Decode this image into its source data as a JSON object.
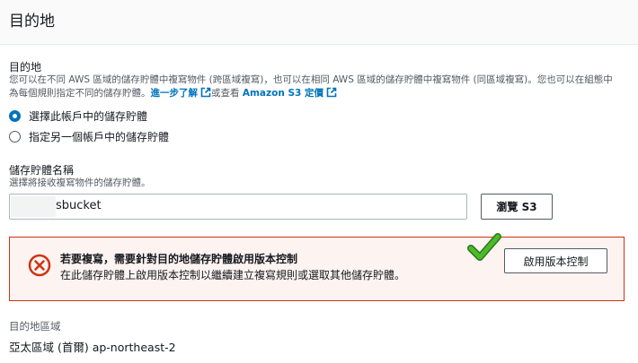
{
  "header": {
    "title": "目的地"
  },
  "destination": {
    "label": "目的地",
    "desc_line1": "您可以在不同 AWS 區域的儲存貯體中複寫物件 (跨區域複寫)，也可以在相同 AWS 區域的儲存貯體中複寫物件 (同區域複寫)。您也可以在組態中",
    "desc_line2_prefix": "為每個規則指定不同的儲存貯體。",
    "learn_more_link": "進一步了解",
    "desc_or": "或查看",
    "pricing_link": "Amazon S3 定價"
  },
  "radios": [
    {
      "label": "選擇此帳戶中的儲存貯體",
      "checked": true
    },
    {
      "label": "指定另一個帳戶中的儲存貯體",
      "checked": false
    }
  ],
  "bucket": {
    "label": "儲存貯體名稱",
    "hint": "選擇將接收複寫物件的儲存貯體。",
    "value": "sbucket",
    "browse_button": "瀏覽 S3"
  },
  "alert": {
    "title": "若要複寫，需要針對目的地儲存貯體啟用版本控制",
    "description": "在此儲存貯體上啟用版本控制以繼續建立複寫規則或選取其他儲存貯體。",
    "button": "啟用版本控制",
    "icon": "error-circle-icon"
  },
  "annotation": {
    "icon": "green-checkmark-icon",
    "color": "#3ea523"
  },
  "region": {
    "label": "目的地區域",
    "value": "亞太區域 (首爾) ap-northeast-2"
  },
  "colors": {
    "link": "#0073bb",
    "error": "#d13212",
    "radio_selected": "#0073bb"
  }
}
